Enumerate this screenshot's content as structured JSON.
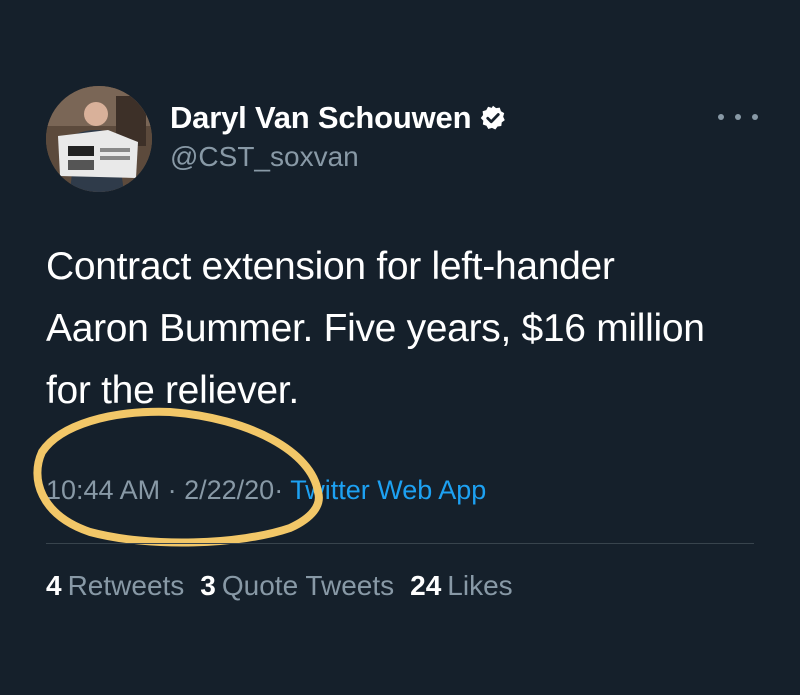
{
  "tweet": {
    "author": {
      "display_name": "Daryl Van Schouwen",
      "handle": "@CST_soxvan",
      "verified": true,
      "verified_icon": "verified-badge-icon",
      "avatar_description": "avatar"
    },
    "more_icon": "more-options-icon",
    "text_lines": [
      "Contract extension for left-hander",
      "Aaron Bummer. Five years, $16 million",
      "for the reliever."
    ],
    "time": "10:44 AM",
    "separator": "·",
    "date": "2/22/20",
    "source": "Twitter Web App",
    "stats": [
      {
        "count": "4",
        "label": "Retweets"
      },
      {
        "count": "3",
        "label": "Quote Tweets"
      },
      {
        "count": "24",
        "label": "Likes"
      }
    ]
  },
  "colors": {
    "background": "#15202b",
    "text_primary": "#ffffff",
    "text_secondary": "#8899a6",
    "link": "#1da1f2",
    "divider": "#38444d",
    "annotation": "#f2c768"
  }
}
